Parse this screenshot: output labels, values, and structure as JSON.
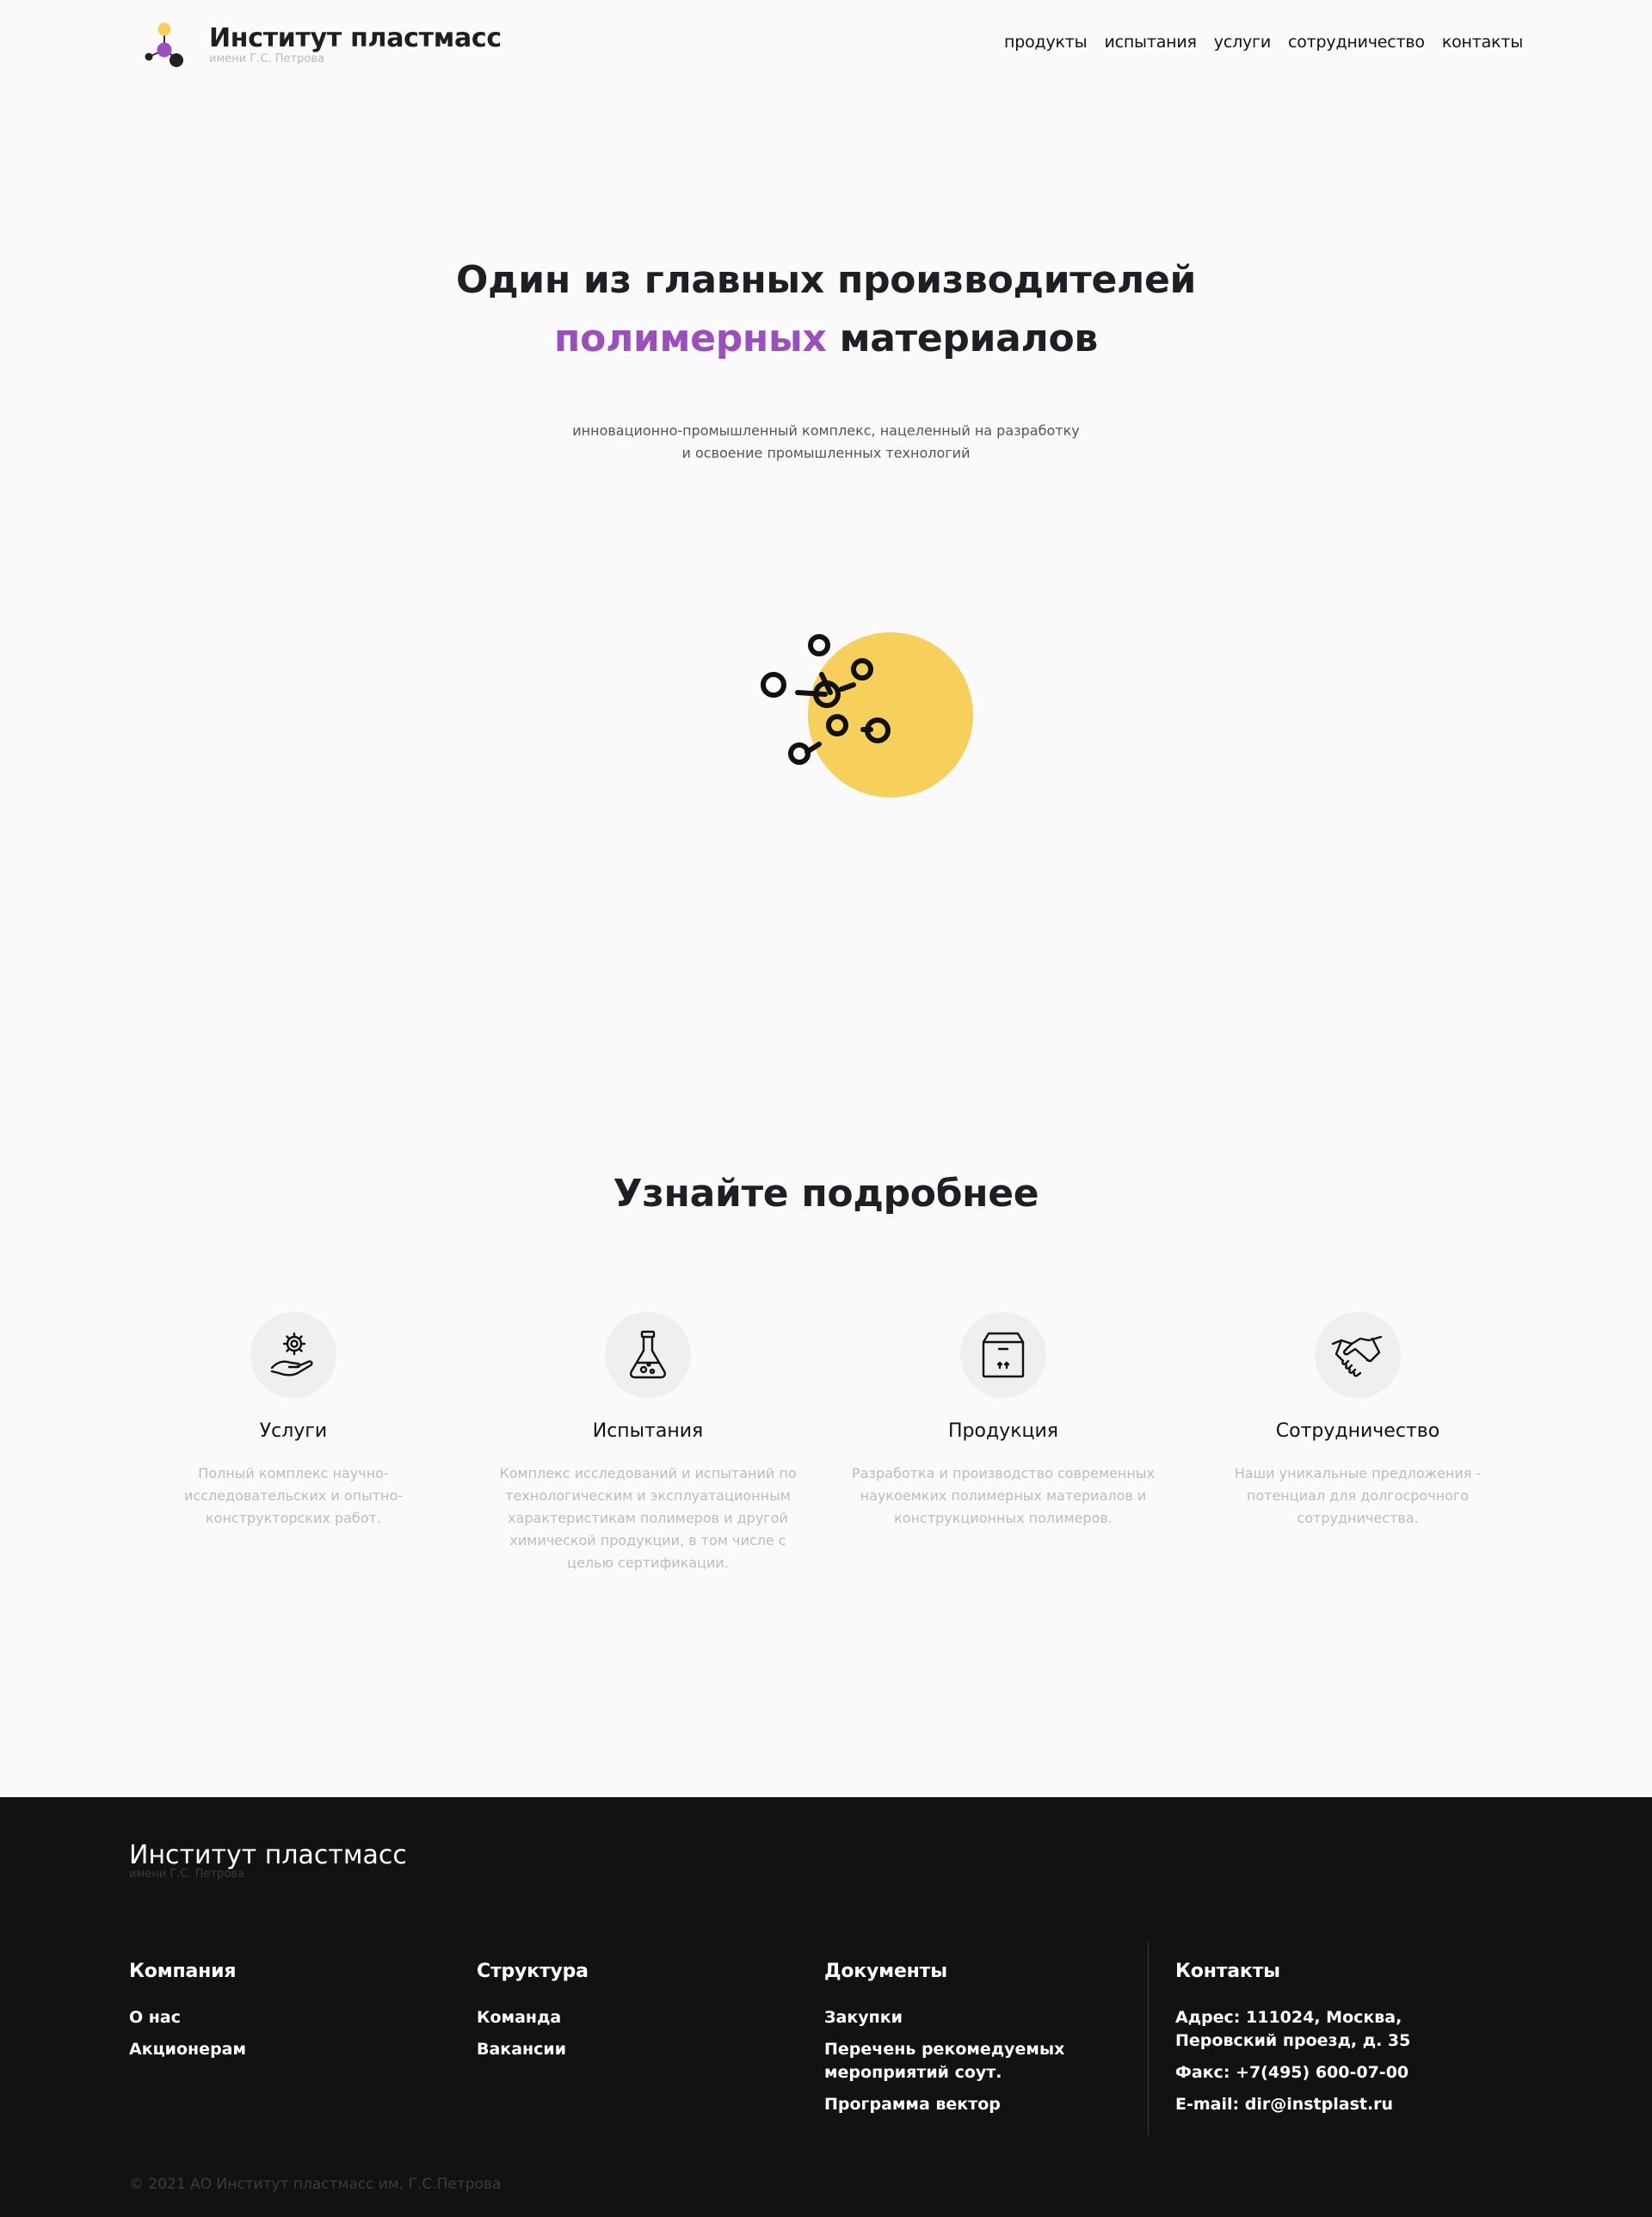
{
  "header": {
    "logo_title": "Институт пластмасс",
    "logo_subtitle": "имени Г.С. Петрова",
    "nav": [
      "продукты",
      "испытания",
      "услуги",
      "сотрудничество",
      "контакты"
    ]
  },
  "hero": {
    "title_line1": "Один из главных производителей",
    "title_accent": "полимерных",
    "title_rest": " материалов",
    "subtitle": "инновационно-промышленный комплекс, нацеленный на разработку и освоение промышленных технологий"
  },
  "features": {
    "title": "Узнайте подробнее",
    "items": [
      {
        "icon": "gear-hand-icon",
        "title": "Услуги",
        "desc": "Полный комплекс научно-исследовательских и опытно-конструкторских работ."
      },
      {
        "icon": "flask-icon",
        "title": "Испытания",
        "desc": "Комплекс исследований и испытаний по технологическим и эксплуатационным характеристикам полимеров и другой химической продукции, в том числе с целью сертификации."
      },
      {
        "icon": "box-icon",
        "title": "Продукция",
        "desc": "Разработка и производство современных наукоемких полимерных материалов и конструкционных полимеров."
      },
      {
        "icon": "handshake-icon",
        "title": "Сотрудничество",
        "desc": "Наши уникальные предложения - потенциал для долгосрочного сотрудничества."
      }
    ]
  },
  "footer": {
    "logo_title": "Институт пластмасс",
    "logo_subtitle": "имени Г.С. Петрова",
    "company": {
      "heading": "Компания",
      "links": [
        "О нас",
        "Акционерам"
      ]
    },
    "structure": {
      "heading": "Структура",
      "links": [
        "Команда",
        "Вакансии"
      ]
    },
    "documents": {
      "heading": "Документы",
      "links": [
        "Закупки",
        "Перечень рекомедуемых мероприятий соут.",
        "Программа вектор"
      ]
    },
    "contacts": {
      "heading": "Контакты",
      "address": "Адрес: 111024, Москва, Перовский проезд, д. 35",
      "fax": "Факс: +7(495) 600-07-00",
      "email": "E-mail: dir@instplast.ru"
    },
    "copyright": "© 2021 АО Институт пластмасс им. Г.С.Петрова"
  },
  "colors": {
    "accent": "#9b4fbf",
    "yellow": "#f7d05c",
    "footer_bg": "#121212"
  }
}
